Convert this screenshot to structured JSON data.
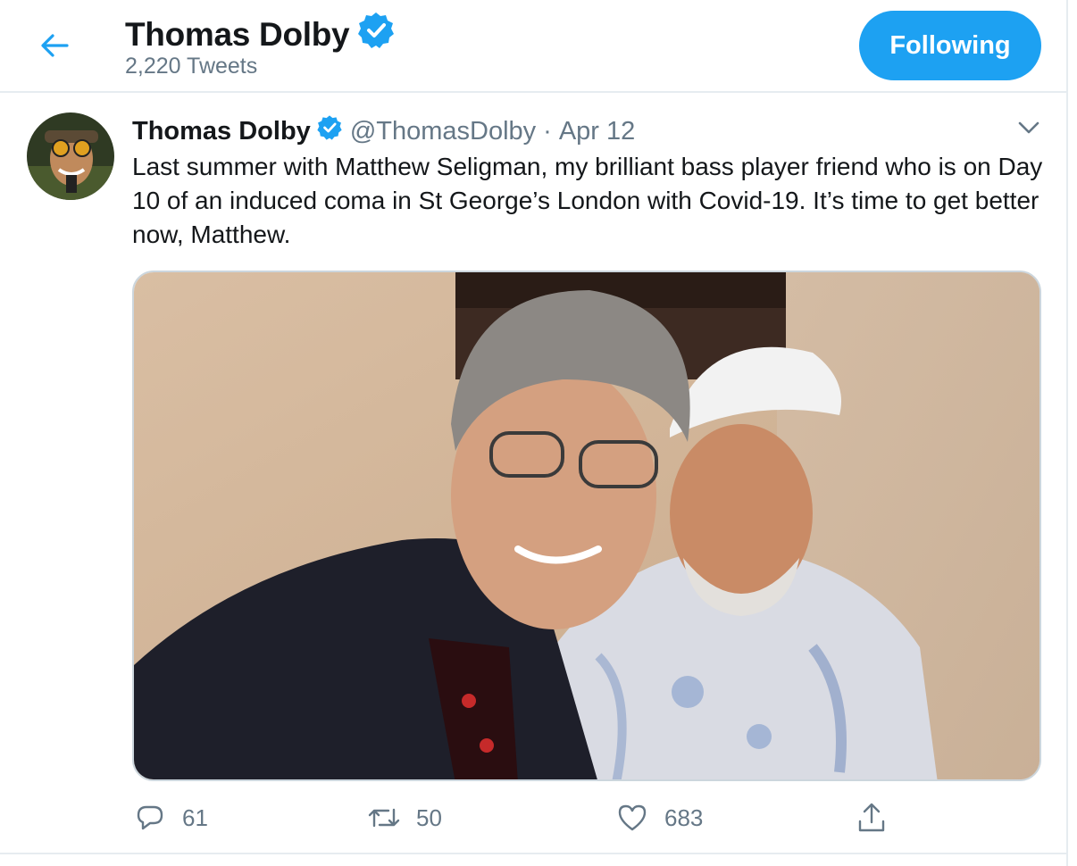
{
  "header": {
    "back_icon": "arrow-left-icon",
    "name": "Thomas Dolby",
    "verified_icon": "verified-badge-icon",
    "tweet_count": "2,220 Tweets",
    "follow_label": "Following"
  },
  "tweet": {
    "author_name": "Thomas Dolby",
    "handle": "@ThomasDolby",
    "separator": "·",
    "date": "Apr 12",
    "text": "Last summer with Matthew Seligman, my brilliant bass player friend who is on Day 10 of an induced coma in St George’s London with Covid-19. It’s time to get better now, Matthew.",
    "media_icon": "photo",
    "menu_icon": "chevron-down-icon",
    "actions": {
      "reply_count": "61",
      "retweet_count": "50",
      "like_count": "683",
      "share_icon": "share-icon"
    }
  },
  "colors": {
    "accent": "#1da1f2",
    "text": "#14171a",
    "secondary": "#657786",
    "border": "#e6ecf0"
  }
}
